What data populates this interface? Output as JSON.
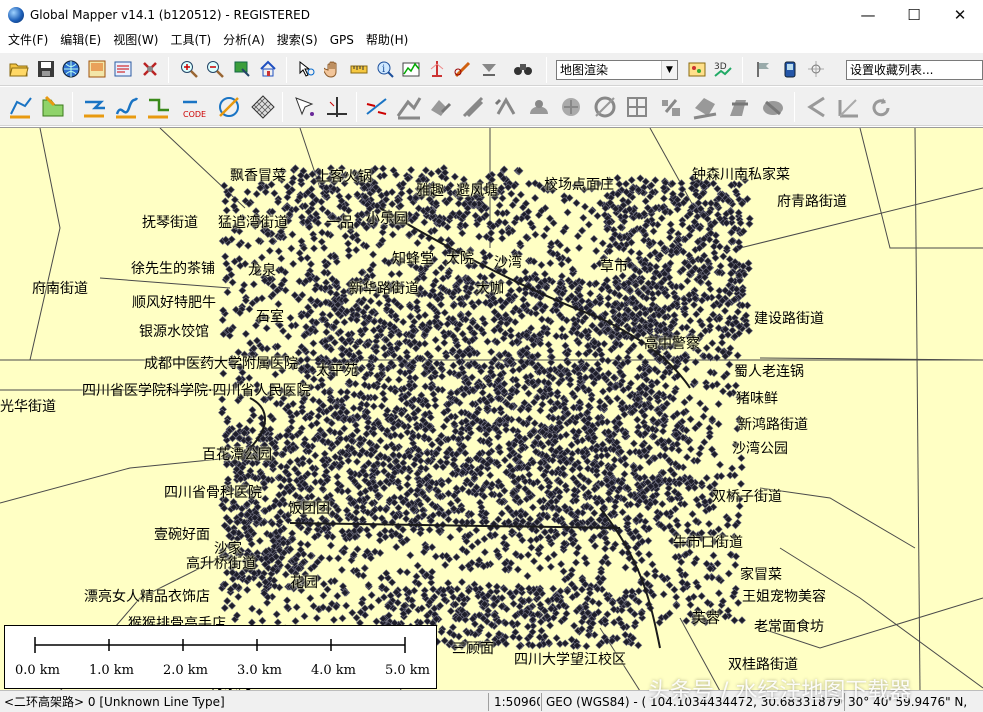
{
  "window": {
    "title": "Global Mapper v14.1 (b120512) - REGISTERED",
    "minimize": "—",
    "maximize": "☐",
    "close": "✕"
  },
  "menu": [
    "文件(F)",
    "编辑(E)",
    "视图(W)",
    "工具(T)",
    "分析(A)",
    "搜索(S)",
    "GPS",
    "帮助(H)"
  ],
  "toolbar": {
    "layer_combo": "地图渲染",
    "bookmark_combo": "设置收藏列表..."
  },
  "map": {
    "labels": [
      {
        "text": "飘香冒菜"
      },
      {
        "text": "上客火锅"
      },
      {
        "text": "雅趣"
      },
      {
        "text": "避风塘"
      },
      {
        "text": "校场点面庄"
      },
      {
        "text": "钟森川南私家菜"
      },
      {
        "text": "府青路街道"
      },
      {
        "text": "抚琴街道"
      },
      {
        "text": "猛追湾街道"
      },
      {
        "text": "一品"
      },
      {
        "text": "小乐园"
      },
      {
        "text": "知蜂堂"
      },
      {
        "text": "大院"
      },
      {
        "text": "沙湾"
      },
      {
        "text": "徐先生的茶铺"
      },
      {
        "text": "龙泉"
      },
      {
        "text": "新华路街道"
      },
      {
        "text": "大咖"
      },
      {
        "text": "草市"
      },
      {
        "text": "府南街道"
      },
      {
        "text": "顺风好特肥牛"
      },
      {
        "text": "石室"
      },
      {
        "text": "建设路街道"
      },
      {
        "text": "银源水饺馆"
      },
      {
        "text": "成都中医药大学附属医院"
      },
      {
        "text": "高中警察"
      },
      {
        "text": "四川省医学院科学院·四川省人民医院"
      },
      {
        "text": "太平苑"
      },
      {
        "text": "蜀人老连锅"
      },
      {
        "text": "光华街道"
      },
      {
        "text": "猪味鲜"
      },
      {
        "text": "新鸿路街道"
      },
      {
        "text": "百花潭公园"
      },
      {
        "text": "沙湾公园"
      },
      {
        "text": "四川省骨科医院"
      },
      {
        "text": "饭团团"
      },
      {
        "text": "双桥子街道"
      },
      {
        "text": "壹碗好面"
      },
      {
        "text": "高升桥街道"
      },
      {
        "text": "牛市口街道"
      },
      {
        "text": "漂亮女人精品衣饰店"
      },
      {
        "text": "家冒菜"
      },
      {
        "text": "王姐宠物美容"
      },
      {
        "text": "猴猴排骨高手店"
      },
      {
        "text": "芙蓉"
      },
      {
        "text": "老常面食坊"
      },
      {
        "text": "红牌楼街道"
      },
      {
        "text": "欢乐时光手工坊"
      },
      {
        "text": "浆洗街街道"
      },
      {
        "text": "成都市"
      },
      {
        "text": "三顾面"
      },
      {
        "text": "四川大学望江校区"
      },
      {
        "text": "双桂路街道"
      },
      {
        "text": "肖家河"
      },
      {
        "text": "锦官城"
      },
      {
        "text": "花园"
      },
      {
        "text": "沙家"
      }
    ]
  },
  "scale": {
    "labels": [
      "0.0 km",
      "1.0 km",
      "2.0 km",
      "3.0 km",
      "4.0 km",
      "5.0 km"
    ]
  },
  "status": {
    "layer": "<二环高架路> 0 [Unknown Line Type]",
    "scale": "1:50960",
    "coords": "GEO (WGS84) - ( 104.1034434472, 30.6833187906 )",
    "dms": "30° 40' 59.9476\" N,"
  },
  "watermark": "头条号 / 水经注地图下载器"
}
